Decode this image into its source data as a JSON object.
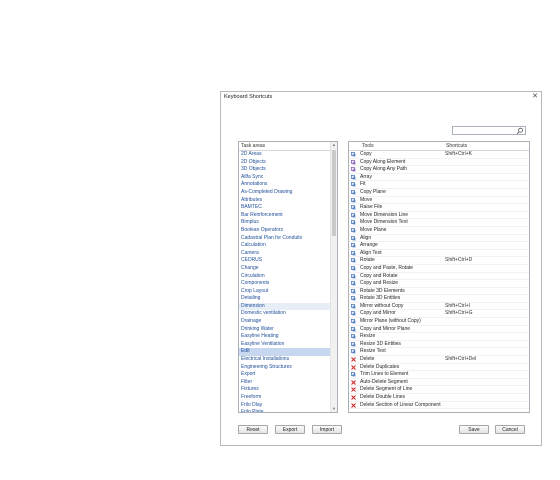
{
  "dialog": {
    "title": "Keyboard Shortcuts",
    "close_glyph": "✕"
  },
  "search": {
    "placeholder": "",
    "icon": "search-icon"
  },
  "task_areas": {
    "header": "Task areas",
    "selected": "Edit",
    "items": [
      "2D Areas",
      "2D Objects",
      "3D Objects",
      "Allfa Sync",
      "Annotations",
      "As-Completed Drawing",
      "Attributes",
      "BAMTEC",
      "Bar Reinforcement",
      "Bimplus",
      "Boolean Operators",
      "Cadastral Plan for Conduits",
      "Calculation",
      "Camera",
      "CEDRUS",
      "Change",
      "Circulation",
      "Components",
      "Crop Layout",
      "Detailing",
      "Dimension",
      "Domestic ventilation",
      "Drainage",
      "Drinking Water",
      "Easyline Heating",
      "Easyline Ventilation",
      "Edit",
      "Electrical Installations",
      "Engineering Structures",
      "Export",
      "Filter",
      "Fixtures",
      "Freeform",
      "Frilo Dlay",
      "Frilo Plate"
    ]
  },
  "tools": {
    "col_tools": "Tools",
    "col_shortcuts": "Shortcuts",
    "rows": [
      {
        "name": "Copy",
        "shortcut": "Shift+Ctrl+K",
        "icon": "copy-icon",
        "color": "#3a6db5"
      },
      {
        "name": "Copy Along Element",
        "shortcut": "",
        "icon": "copy-along-element-icon",
        "color": "#7a4cb0"
      },
      {
        "name": "Copy Along Any Path",
        "shortcut": "",
        "icon": "copy-along-path-icon",
        "color": "#7a4cb0"
      },
      {
        "name": "Array",
        "shortcut": "",
        "icon": "array-icon",
        "color": "#3a6db5"
      },
      {
        "name": "Fit",
        "shortcut": "",
        "icon": "fit-icon",
        "color": "#3a6db5"
      },
      {
        "name": "Copy Plane",
        "shortcut": "",
        "icon": "copy-plane-icon",
        "color": "#3a6db5"
      },
      {
        "name": "Move",
        "shortcut": "",
        "icon": "move-icon",
        "color": "#3a6db5"
      },
      {
        "name": "Raise File",
        "shortcut": "",
        "icon": "raise-file-icon",
        "color": "#3a6db5"
      },
      {
        "name": "Move Dimension Line",
        "shortcut": "",
        "icon": "move-dimension-line-icon",
        "color": "#3a6db5"
      },
      {
        "name": "Move Dimension Text",
        "shortcut": "",
        "icon": "move-dimension-text-icon",
        "color": "#3a6db5"
      },
      {
        "name": "Move Plane",
        "shortcut": "",
        "icon": "move-plane-icon",
        "color": "#3a6db5"
      },
      {
        "name": "Align",
        "shortcut": "",
        "icon": "align-icon",
        "color": "#3a6db5"
      },
      {
        "name": "Arrange",
        "shortcut": "",
        "icon": "arrange-icon",
        "color": "#3a6db5"
      },
      {
        "name": "Align Text",
        "shortcut": "",
        "icon": "align-text-icon",
        "color": "#3a6db5"
      },
      {
        "name": "Rotate",
        "shortcut": "Shift+Ctrl+D",
        "icon": "rotate-icon",
        "color": "#3a6db5"
      },
      {
        "name": "Copy and Paste, Rotate",
        "shortcut": "",
        "icon": "copy-paste-rotate-icon",
        "color": "#3a6db5"
      },
      {
        "name": "Copy and Rotate",
        "shortcut": "",
        "icon": "copy-rotate-icon",
        "color": "#3a6db5"
      },
      {
        "name": "Copy and Resize",
        "shortcut": "",
        "icon": "copy-resize-icon",
        "color": "#3a6db5"
      },
      {
        "name": "Rotate 3D Elements",
        "shortcut": "",
        "icon": "rotate-3d-icon",
        "color": "#3a6db5"
      },
      {
        "name": "Rotate 3D Entities",
        "shortcut": "",
        "icon": "rotate-3d-entities-icon",
        "color": "#3a6db5"
      },
      {
        "name": "Mirror without Copy",
        "shortcut": "Shift+Ctrl+I",
        "icon": "mirror-icon",
        "color": "#3a6db5"
      },
      {
        "name": "Copy and Mirror",
        "shortcut": "Shift+Ctrl+G",
        "icon": "copy-mirror-icon",
        "color": "#3a6db5"
      },
      {
        "name": "Mirror Plane (without Copy)",
        "shortcut": "",
        "icon": "mirror-plane-icon",
        "color": "#3a6db5"
      },
      {
        "name": "Copy and Mirror Plane",
        "shortcut": "",
        "icon": "copy-mirror-plane-icon",
        "color": "#3a6db5"
      },
      {
        "name": "Resize",
        "shortcut": "",
        "icon": "resize-icon",
        "color": "#3a6db5"
      },
      {
        "name": "Resize 3D Entities",
        "shortcut": "",
        "icon": "resize-3d-icon",
        "color": "#3a6db5"
      },
      {
        "name": "Resize Text",
        "shortcut": "",
        "icon": "resize-text-icon",
        "color": "#3a6db5"
      },
      {
        "name": "Delete",
        "shortcut": "Shift+Ctrl+Del",
        "icon": "delete-icon",
        "color": "#d12a2a"
      },
      {
        "name": "Delete Duplicates",
        "shortcut": "",
        "icon": "delete-duplicates-icon",
        "color": "#d12a2a"
      },
      {
        "name": "Trim Lines to Element",
        "shortcut": "",
        "icon": "trim-lines-icon",
        "color": "#3a6db5"
      },
      {
        "name": "Auto-Delete Segment",
        "shortcut": "",
        "icon": "auto-delete-segment-icon",
        "color": "#d12a2a"
      },
      {
        "name": "Delete Segment of Line",
        "shortcut": "",
        "icon": "delete-segment-icon",
        "color": "#d12a2a"
      },
      {
        "name": "Delete Double Lines",
        "shortcut": "",
        "icon": "delete-double-lines-icon",
        "color": "#d12a2a"
      },
      {
        "name": "Delete Section of Linear Component",
        "shortcut": "",
        "icon": "delete-section-icon",
        "color": "#d12a2a"
      }
    ]
  },
  "buttons": {
    "reset": "Reset",
    "export": "Export",
    "import": "Import",
    "save": "Save",
    "cancel": "Cancel"
  }
}
